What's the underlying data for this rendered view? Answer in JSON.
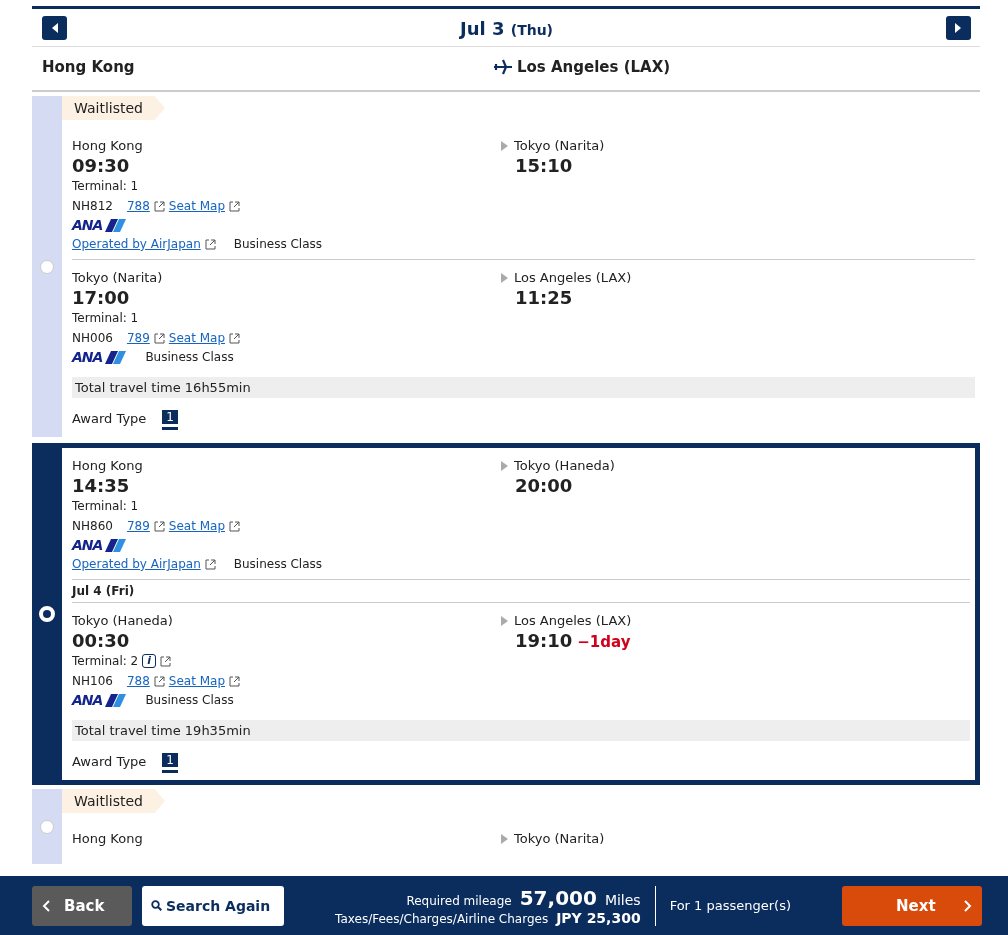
{
  "date_nav": {
    "date": "Jul 3",
    "weekday": "(Thu)"
  },
  "route": {
    "origin": "Hong Kong",
    "destination": "Los Angeles (LAX)"
  },
  "options": [
    {
      "selected": false,
      "waitlisted": true,
      "waitlist_label": "Waitlisted",
      "segments": [
        {
          "from": "Hong Kong",
          "dep_time": "09:30",
          "terminal": "Terminal: 1",
          "flight": "NH812",
          "aircraft": "788",
          "seat_map": "Seat Map",
          "airline_logo": "ANA",
          "operated_by": "Operated by AirJapan",
          "cabin": "Business Class",
          "to": "Tokyo (Narita)",
          "arr_time": "15:10"
        },
        {
          "from": "Tokyo (Narita)",
          "dep_time": "17:00",
          "terminal": "Terminal: 1",
          "flight": "NH006",
          "aircraft": "789",
          "seat_map": "Seat Map",
          "airline_logo": "ANA",
          "cabin": "Business Class",
          "to": "Los Angeles (LAX)",
          "arr_time": "11:25"
        }
      ],
      "total_time": "Total travel time 16h55min",
      "award_label": "Award Type",
      "award_type": "1"
    },
    {
      "selected": true,
      "waitlisted": false,
      "segments": [
        {
          "from": "Hong Kong",
          "dep_time": "14:35",
          "terminal": "Terminal: 1",
          "flight": "NH860",
          "aircraft": "789",
          "seat_map": "Seat Map",
          "airline_logo": "ANA",
          "operated_by": "Operated by AirJapan",
          "cabin": "Business Class",
          "to": "Tokyo (Haneda)",
          "arr_time": "20:00"
        },
        {
          "date_header": "Jul 4 (Fri)",
          "from": "Tokyo (Haneda)",
          "dep_time": "00:30",
          "terminal": "Terminal: 2",
          "info_icon": "i",
          "flight": "NH106",
          "aircraft": "788",
          "seat_map": "Seat Map",
          "airline_logo": "ANA",
          "cabin": "Business Class",
          "to": "Los Angeles (LAX)",
          "arr_time": "19:10",
          "day_offset": "−1day"
        }
      ],
      "total_time": "Total travel time 19h35min",
      "award_label": "Award Type",
      "award_type": "1"
    },
    {
      "selected": false,
      "waitlisted": true,
      "waitlist_label": "Waitlisted",
      "segments": [
        {
          "from": "Hong Kong",
          "to": "Tokyo (Narita)"
        }
      ]
    }
  ],
  "footer": {
    "back": "Back",
    "search_again": "Search Again",
    "mileage_label": "Required mileage",
    "mileage": "57,000",
    "mileage_unit": "Miles",
    "taxes_label": "Taxes/Fees/Charges/Airline Charges",
    "currency": "JPY",
    "taxes": "25,300",
    "passengers": "For 1 passenger(s)",
    "next": "Next"
  }
}
